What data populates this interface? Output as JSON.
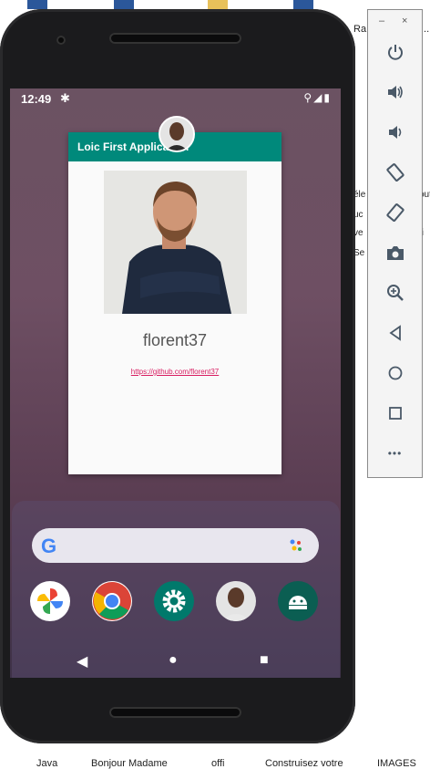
{
  "desktop": {
    "right_texts": [
      "Ra",
      "...",
      "éle",
      "out",
      "uc",
      "ve",
      "ti",
      "Se"
    ],
    "taskbar": [
      "Java",
      "Bonjour Madame",
      "offi",
      "Construisez votre",
      "IMAGES"
    ]
  },
  "status_bar": {
    "time": "12:49",
    "icons": [
      "settings-icon",
      "location-icon",
      "signal-icon",
      "battery-icon"
    ]
  },
  "app": {
    "title": "Loic First Application",
    "username": "florent37",
    "link": "https://github.com/florent37"
  },
  "home": {
    "search_logo": "G",
    "dock_apps": [
      "Photos",
      "Chrome",
      "Settings",
      "Contacts",
      "Android"
    ]
  },
  "navbar": {
    "back": "◀",
    "home": "●",
    "overview": "■"
  },
  "toolbar": {
    "minimize": "–",
    "close": "×",
    "more": "•••",
    "buttons": [
      "power",
      "volume-up",
      "volume-down",
      "rotate-left",
      "rotate-right",
      "screenshot",
      "zoom",
      "back",
      "home",
      "overview",
      "more"
    ]
  },
  "colors": {
    "app_bar": "#00897b",
    "link": "#d81b60",
    "toolbar_icons": "#4a5968"
  }
}
